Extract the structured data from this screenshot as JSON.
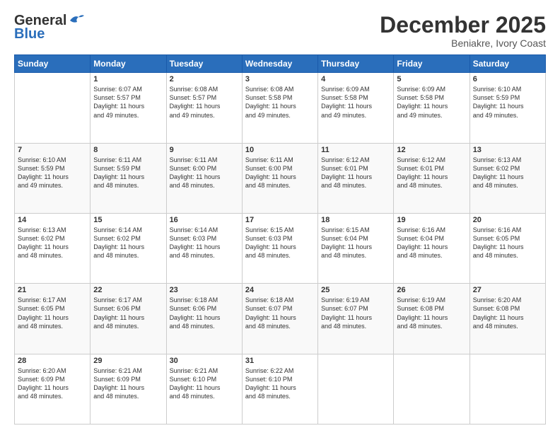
{
  "header": {
    "logo_line1": "General",
    "logo_line2": "Blue",
    "month": "December 2025",
    "location": "Beniakre, Ivory Coast"
  },
  "weekdays": [
    "Sunday",
    "Monday",
    "Tuesday",
    "Wednesday",
    "Thursday",
    "Friday",
    "Saturday"
  ],
  "weeks": [
    [
      {
        "day": "",
        "info": ""
      },
      {
        "day": "1",
        "info": "Sunrise: 6:07 AM\nSunset: 5:57 PM\nDaylight: 11 hours\nand 49 minutes."
      },
      {
        "day": "2",
        "info": "Sunrise: 6:08 AM\nSunset: 5:57 PM\nDaylight: 11 hours\nand 49 minutes."
      },
      {
        "day": "3",
        "info": "Sunrise: 6:08 AM\nSunset: 5:58 PM\nDaylight: 11 hours\nand 49 minutes."
      },
      {
        "day": "4",
        "info": "Sunrise: 6:09 AM\nSunset: 5:58 PM\nDaylight: 11 hours\nand 49 minutes."
      },
      {
        "day": "5",
        "info": "Sunrise: 6:09 AM\nSunset: 5:58 PM\nDaylight: 11 hours\nand 49 minutes."
      },
      {
        "day": "6",
        "info": "Sunrise: 6:10 AM\nSunset: 5:59 PM\nDaylight: 11 hours\nand 49 minutes."
      }
    ],
    [
      {
        "day": "7",
        "info": "Sunrise: 6:10 AM\nSunset: 5:59 PM\nDaylight: 11 hours\nand 49 minutes."
      },
      {
        "day": "8",
        "info": "Sunrise: 6:11 AM\nSunset: 5:59 PM\nDaylight: 11 hours\nand 48 minutes."
      },
      {
        "day": "9",
        "info": "Sunrise: 6:11 AM\nSunset: 6:00 PM\nDaylight: 11 hours\nand 48 minutes."
      },
      {
        "day": "10",
        "info": "Sunrise: 6:11 AM\nSunset: 6:00 PM\nDaylight: 11 hours\nand 48 minutes."
      },
      {
        "day": "11",
        "info": "Sunrise: 6:12 AM\nSunset: 6:01 PM\nDaylight: 11 hours\nand 48 minutes."
      },
      {
        "day": "12",
        "info": "Sunrise: 6:12 AM\nSunset: 6:01 PM\nDaylight: 11 hours\nand 48 minutes."
      },
      {
        "day": "13",
        "info": "Sunrise: 6:13 AM\nSunset: 6:02 PM\nDaylight: 11 hours\nand 48 minutes."
      }
    ],
    [
      {
        "day": "14",
        "info": "Sunrise: 6:13 AM\nSunset: 6:02 PM\nDaylight: 11 hours\nand 48 minutes."
      },
      {
        "day": "15",
        "info": "Sunrise: 6:14 AM\nSunset: 6:02 PM\nDaylight: 11 hours\nand 48 minutes."
      },
      {
        "day": "16",
        "info": "Sunrise: 6:14 AM\nSunset: 6:03 PM\nDaylight: 11 hours\nand 48 minutes."
      },
      {
        "day": "17",
        "info": "Sunrise: 6:15 AM\nSunset: 6:03 PM\nDaylight: 11 hours\nand 48 minutes."
      },
      {
        "day": "18",
        "info": "Sunrise: 6:15 AM\nSunset: 6:04 PM\nDaylight: 11 hours\nand 48 minutes."
      },
      {
        "day": "19",
        "info": "Sunrise: 6:16 AM\nSunset: 6:04 PM\nDaylight: 11 hours\nand 48 minutes."
      },
      {
        "day": "20",
        "info": "Sunrise: 6:16 AM\nSunset: 6:05 PM\nDaylight: 11 hours\nand 48 minutes."
      }
    ],
    [
      {
        "day": "21",
        "info": "Sunrise: 6:17 AM\nSunset: 6:05 PM\nDaylight: 11 hours\nand 48 minutes."
      },
      {
        "day": "22",
        "info": "Sunrise: 6:17 AM\nSunset: 6:06 PM\nDaylight: 11 hours\nand 48 minutes."
      },
      {
        "day": "23",
        "info": "Sunrise: 6:18 AM\nSunset: 6:06 PM\nDaylight: 11 hours\nand 48 minutes."
      },
      {
        "day": "24",
        "info": "Sunrise: 6:18 AM\nSunset: 6:07 PM\nDaylight: 11 hours\nand 48 minutes."
      },
      {
        "day": "25",
        "info": "Sunrise: 6:19 AM\nSunset: 6:07 PM\nDaylight: 11 hours\nand 48 minutes."
      },
      {
        "day": "26",
        "info": "Sunrise: 6:19 AM\nSunset: 6:08 PM\nDaylight: 11 hours\nand 48 minutes."
      },
      {
        "day": "27",
        "info": "Sunrise: 6:20 AM\nSunset: 6:08 PM\nDaylight: 11 hours\nand 48 minutes."
      }
    ],
    [
      {
        "day": "28",
        "info": "Sunrise: 6:20 AM\nSunset: 6:09 PM\nDaylight: 11 hours\nand 48 minutes."
      },
      {
        "day": "29",
        "info": "Sunrise: 6:21 AM\nSunset: 6:09 PM\nDaylight: 11 hours\nand 48 minutes."
      },
      {
        "day": "30",
        "info": "Sunrise: 6:21 AM\nSunset: 6:10 PM\nDaylight: 11 hours\nand 48 minutes."
      },
      {
        "day": "31",
        "info": "Sunrise: 6:22 AM\nSunset: 6:10 PM\nDaylight: 11 hours\nand 48 minutes."
      },
      {
        "day": "",
        "info": ""
      },
      {
        "day": "",
        "info": ""
      },
      {
        "day": "",
        "info": ""
      }
    ]
  ]
}
